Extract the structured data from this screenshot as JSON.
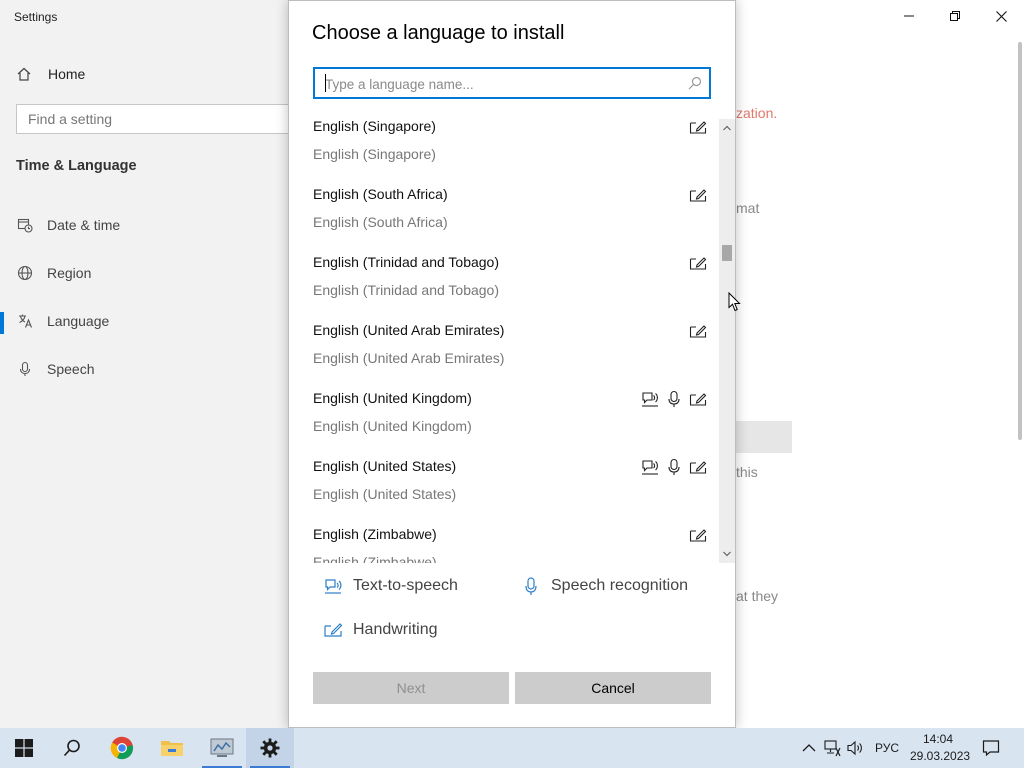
{
  "settings": {
    "app_title": "Settings",
    "home_label": "Home",
    "search_placeholder": "Find a setting",
    "section_title": "Time & Language",
    "nav": [
      {
        "label": "Date & time",
        "icon": "calendar-clock-icon"
      },
      {
        "label": "Region",
        "icon": "globe-icon"
      },
      {
        "label": "Language",
        "icon": "language-icon",
        "active": true
      },
      {
        "label": "Speech",
        "icon": "microphone-icon"
      }
    ],
    "background_texts": {
      "t1": "zation.",
      "t2": "mat",
      "t3": "this",
      "t4": "at they"
    }
  },
  "dialog": {
    "title": "Choose a language to install",
    "search_placeholder": "Type a language name...",
    "languages": [
      {
        "name": "English (Singapore)",
        "native": "English (Singapore)",
        "features": [
          "handwriting"
        ]
      },
      {
        "name": "English (South Africa)",
        "native": "English (South Africa)",
        "features": [
          "handwriting"
        ]
      },
      {
        "name": "English (Trinidad and Tobago)",
        "native": "English (Trinidad and Tobago)",
        "features": [
          "handwriting"
        ]
      },
      {
        "name": "English (United Arab Emirates)",
        "native": "English (United Arab Emirates)",
        "features": [
          "handwriting"
        ]
      },
      {
        "name": "English (United Kingdom)",
        "native": "English (United Kingdom)",
        "features": [
          "text-to-speech",
          "speech-recognition",
          "handwriting"
        ]
      },
      {
        "name": "English (United States)",
        "native": "English (United States)",
        "features": [
          "text-to-speech",
          "speech-recognition",
          "handwriting"
        ]
      },
      {
        "name": "English (Zimbabwe)",
        "native": "English (Zimbabwe)",
        "features": [
          "handwriting"
        ]
      }
    ],
    "legend": {
      "tts": "Text-to-speech",
      "speech": "Speech recognition",
      "handwriting": "Handwriting"
    },
    "buttons": {
      "next": "Next",
      "cancel": "Cancel"
    }
  },
  "taskbar": {
    "apps": [
      "start",
      "search",
      "chrome",
      "file-explorer",
      "control-panel",
      "settings"
    ],
    "input_language": "РУС",
    "time": "14:04",
    "date": "29.03.2023"
  },
  "colors": {
    "accent": "#0078d7",
    "legend_icon": "#2d7fc9",
    "taskbar": "#d9e4f1"
  }
}
